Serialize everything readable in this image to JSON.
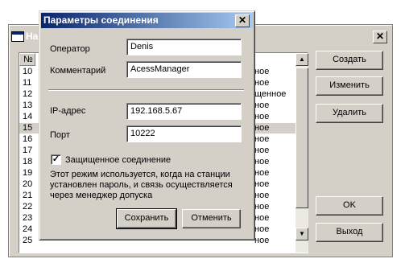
{
  "background_window": {
    "title": "На",
    "list_header": "№",
    "rows": [
      {
        "num": "10",
        "tail": "ное"
      },
      {
        "num": "11",
        "tail": "ное"
      },
      {
        "num": "12",
        "tail": "щенное"
      },
      {
        "num": "13",
        "tail": "ное"
      },
      {
        "num": "14",
        "tail": "ное"
      },
      {
        "num": "15",
        "tail": "ное"
      },
      {
        "num": "16",
        "tail": "ное"
      },
      {
        "num": "17",
        "tail": "ное"
      },
      {
        "num": "18",
        "tail": "ное"
      },
      {
        "num": "19",
        "tail": "ное"
      },
      {
        "num": "20",
        "tail": "ное"
      },
      {
        "num": "21",
        "tail": "ное"
      },
      {
        "num": "22",
        "tail": "ное"
      },
      {
        "num": "23",
        "tail": "ное"
      },
      {
        "num": "24",
        "tail": "ное"
      },
      {
        "num": "25",
        "tail": "ное"
      }
    ],
    "buttons": {
      "create": "Создать",
      "edit": "Изменить",
      "delete": "Удалить",
      "ok": "OK",
      "exit": "Выход"
    }
  },
  "dialog": {
    "title": "Параметры соединения",
    "operator_label": "Оператор",
    "operator_value": "Denis",
    "comment_label": "Комментарий",
    "comment_value": "AcessManager",
    "ip_label": "IP-адрес",
    "ip_value": "192.168.5.67",
    "port_label": "Порт",
    "port_value": "10222",
    "secure_label": "Защищенное соединение",
    "secure_checked": true,
    "info_lines": [
      "Этот режим используется, когда на станции",
      "установлен пароль, и связь осуществляется",
      "через менеджер допуска"
    ],
    "save_label": "Сохранить",
    "cancel_label": "Отменить",
    "close_glyph": "✕"
  }
}
